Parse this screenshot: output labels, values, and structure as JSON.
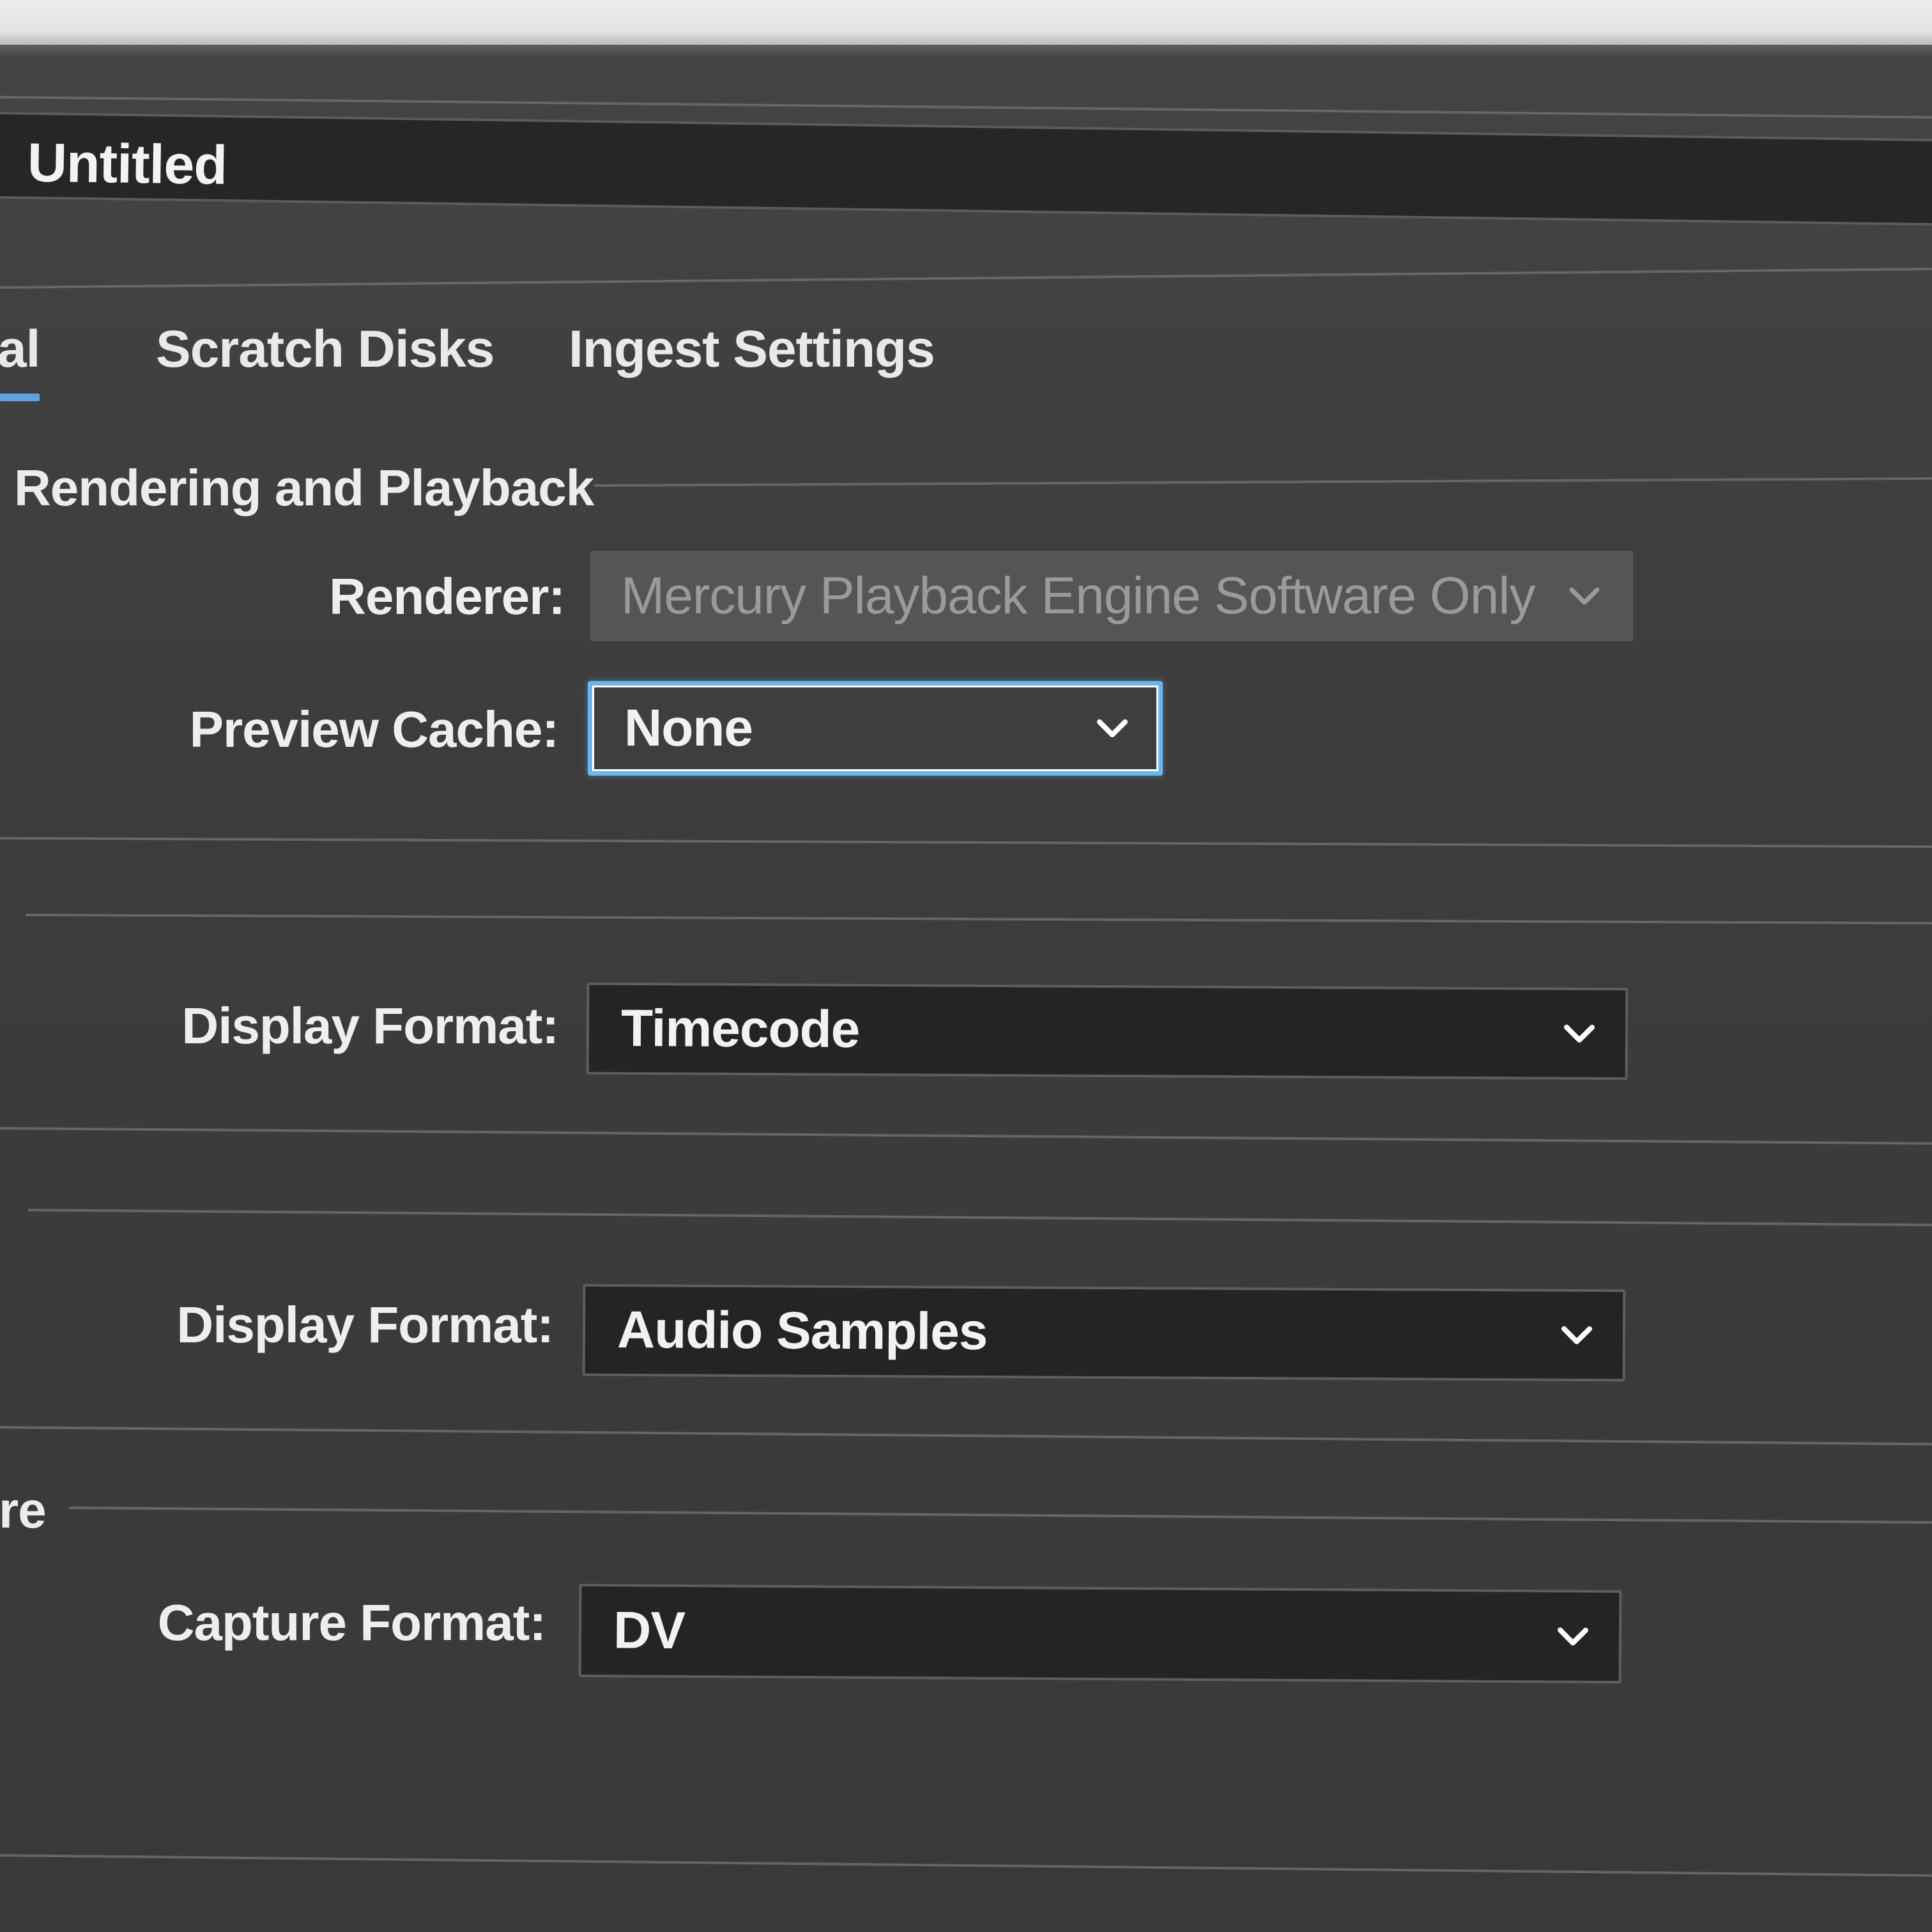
{
  "project": {
    "name": "Untitled"
  },
  "tabs": [
    {
      "label": "al",
      "active": true
    },
    {
      "label": "Scratch Disks",
      "active": false
    },
    {
      "label": "Ingest Settings",
      "active": false
    }
  ],
  "video_rendering": {
    "section_title": "Rendering and Playback",
    "renderer": {
      "label": "Renderer:",
      "value": "Mercury Playback Engine Software Only",
      "enabled": false
    },
    "preview_cache": {
      "label": "Preview Cache:",
      "value": "None",
      "focused": true
    }
  },
  "video": {
    "display_format": {
      "label": "Display Format:",
      "value": "Timecode"
    }
  },
  "audio": {
    "display_format": {
      "label": "Display Format:",
      "value": "Audio Samples"
    }
  },
  "capture": {
    "section_title": "re",
    "capture_format": {
      "label": "Capture Format:",
      "value": "DV"
    }
  },
  "colors": {
    "accent": "#69b7f0",
    "panel_bg": "#3c3c3c",
    "field_bg": "#242424"
  }
}
